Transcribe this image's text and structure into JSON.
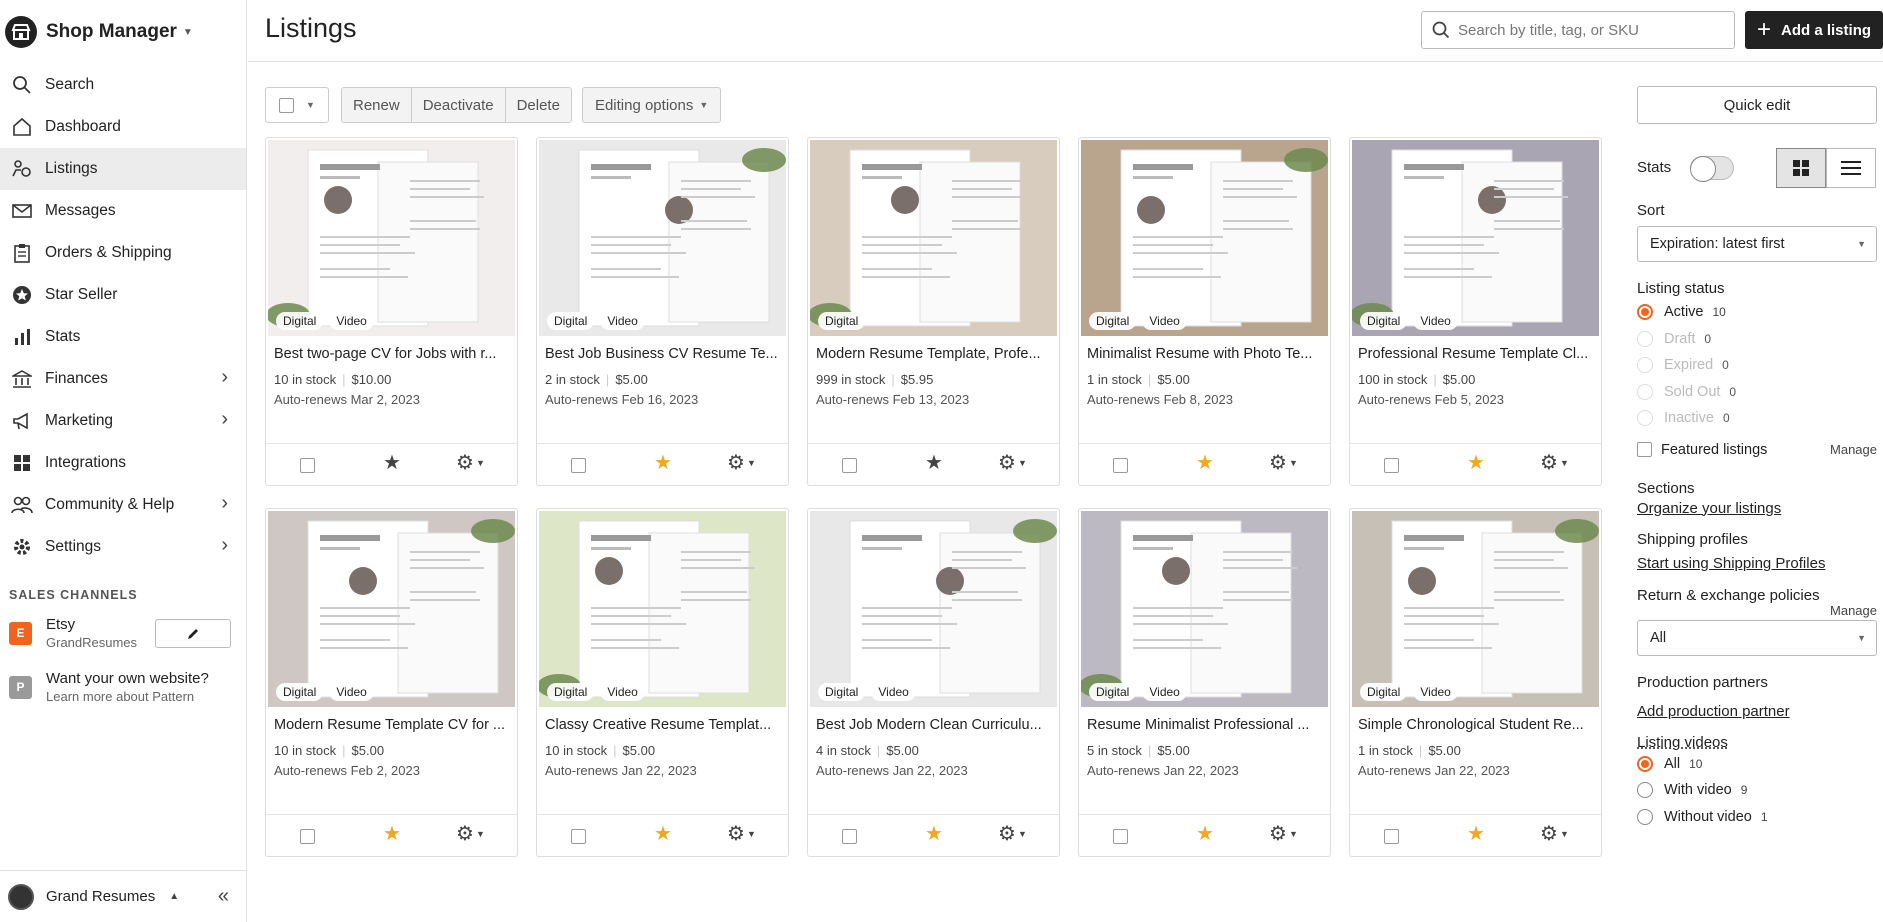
{
  "app": {
    "title": "Shop Manager"
  },
  "sidebar": {
    "items": [
      {
        "label": "Search",
        "icon": "search-icon",
        "active": false,
        "chevron": false
      },
      {
        "label": "Dashboard",
        "icon": "home-icon",
        "active": false,
        "chevron": false
      },
      {
        "label": "Listings",
        "icon": "listings-icon",
        "active": true,
        "chevron": false
      },
      {
        "label": "Messages",
        "icon": "mail-icon",
        "active": false,
        "chevron": false
      },
      {
        "label": "Orders & Shipping",
        "icon": "clipboard-icon",
        "active": false,
        "chevron": false
      },
      {
        "label": "Star Seller",
        "icon": "star-badge-icon",
        "active": false,
        "chevron": false
      },
      {
        "label": "Stats",
        "icon": "bar-chart-icon",
        "active": false,
        "chevron": false
      },
      {
        "label": "Finances",
        "icon": "bank-icon",
        "active": false,
        "chevron": true
      },
      {
        "label": "Marketing",
        "icon": "megaphone-icon",
        "active": false,
        "chevron": true
      },
      {
        "label": "Integrations",
        "icon": "grid-icon",
        "active": false,
        "chevron": false
      },
      {
        "label": "Community & Help",
        "icon": "people-icon",
        "active": false,
        "chevron": true
      },
      {
        "label": "Settings",
        "icon": "gear-icon",
        "active": false,
        "chevron": true
      }
    ],
    "sales_channels_label": "SALES CHANNELS",
    "channels": [
      {
        "badge": "E",
        "name": "Etsy",
        "sub": "GrandResumes",
        "color": "#f1641e"
      },
      {
        "badge": "P",
        "name": "Want your own website?",
        "sub": "Learn more about Pattern",
        "color": "#9a9a9a"
      }
    ],
    "footer_name": "Grand Resumes"
  },
  "header": {
    "title": "Listings",
    "search_placeholder": "Search by title, tag, or SKU",
    "add_label": "Add a listing"
  },
  "toolbar": {
    "renew": "Renew",
    "deactivate": "Deactivate",
    "delete": "Delete",
    "editing": "Editing options"
  },
  "listings": [
    {
      "title": "Best two-page CV for Jobs with r...",
      "stock": "10 in stock",
      "price": "$10.00",
      "renew": "Auto-renews Mar 2, 2023",
      "tags": [
        "Digital",
        "Video"
      ],
      "featured": false,
      "palette": "#f2eeee"
    },
    {
      "title": "Best Job Business CV Resume Te...",
      "stock": "2 in stock",
      "price": "$5.00",
      "renew": "Auto-renews Feb 16, 2023",
      "tags": [
        "Digital",
        "Video"
      ],
      "featured": true,
      "palette": "#e9e9e9"
    },
    {
      "title": "Modern Resume Template, Profe...",
      "stock": "999 in stock",
      "price": "$5.95",
      "renew": "Auto-renews Feb 13, 2023",
      "tags": [
        "Digital"
      ],
      "featured": false,
      "palette": "#d8ccbf"
    },
    {
      "title": "Minimalist Resume with Photo Te...",
      "stock": "1 in stock",
      "price": "$5.00",
      "renew": "Auto-renews Feb 8, 2023",
      "tags": [
        "Digital",
        "Video"
      ],
      "featured": true,
      "palette": "#b9a48d"
    },
    {
      "title": "Professional Resume Template Cl...",
      "stock": "100 in stock",
      "price": "$5.00",
      "renew": "Auto-renews Feb 5, 2023",
      "tags": [
        "Digital",
        "Video"
      ],
      "featured": true,
      "palette": "#aaa5b3"
    },
    {
      "title": "Modern Resume Template CV for ...",
      "stock": "10 in stock",
      "price": "$5.00",
      "renew": "Auto-renews Feb 2, 2023",
      "tags": [
        "Digital",
        "Video"
      ],
      "featured": true,
      "palette": "#cfc7c3"
    },
    {
      "title": "Classy Creative Resume Templat...",
      "stock": "10 in stock",
      "price": "$5.00",
      "renew": "Auto-renews Jan 22, 2023",
      "tags": [
        "Digital",
        "Video"
      ],
      "featured": true,
      "palette": "#dde7c8"
    },
    {
      "title": "Best Job Modern Clean Curriculu...",
      "stock": "4 in stock",
      "price": "$5.00",
      "renew": "Auto-renews Jan 22, 2023",
      "tags": [
        "Digital",
        "Video"
      ],
      "featured": true,
      "palette": "#e8e8e8"
    },
    {
      "title": "Resume Minimalist Professional ...",
      "stock": "5 in stock",
      "price": "$5.00",
      "renew": "Auto-renews Jan 22, 2023",
      "tags": [
        "Digital",
        "Video"
      ],
      "featured": true,
      "palette": "#bdb9c3"
    },
    {
      "title": "Simple Chronological Student Re...",
      "stock": "1 in stock",
      "price": "$5.00",
      "renew": "Auto-renews Jan 22, 2023",
      "tags": [
        "Digital",
        "Video"
      ],
      "featured": true,
      "palette": "#c7c0b7"
    }
  ],
  "panel": {
    "quick_edit": "Quick edit",
    "stats_label": "Stats",
    "sort_label": "Sort",
    "sort_value": "Expiration: latest first",
    "listing_status_label": "Listing status",
    "statuses": [
      {
        "label": "Active",
        "count": "10",
        "selected": true,
        "disabled": false
      },
      {
        "label": "Draft",
        "count": "0",
        "selected": false,
        "disabled": true
      },
      {
        "label": "Expired",
        "count": "0",
        "selected": false,
        "disabled": true
      },
      {
        "label": "Sold Out",
        "count": "0",
        "selected": false,
        "disabled": true
      },
      {
        "label": "Inactive",
        "count": "0",
        "selected": false,
        "disabled": true
      }
    ],
    "featured_label": "Featured listings",
    "manage_label": "Manage",
    "sections_label": "Sections",
    "sections_link": "Organize your listings",
    "shipping_label": "Shipping profiles",
    "shipping_link": "Start using Shipping Profiles",
    "return_label": "Return & exchange policies",
    "return_value": "All",
    "production_label": "Production partners",
    "production_link": "Add production partner",
    "videos_label": "Listing videos",
    "videos": [
      {
        "label": "All",
        "count": "10",
        "selected": true
      },
      {
        "label": "With video",
        "count": "9",
        "selected": false
      },
      {
        "label": "Without video",
        "count": "1",
        "selected": false
      }
    ]
  },
  "colors": {
    "accent": "#f1641e",
    "star_on": "#f1a81e",
    "star_off": "#444444",
    "dark": "#222222"
  }
}
